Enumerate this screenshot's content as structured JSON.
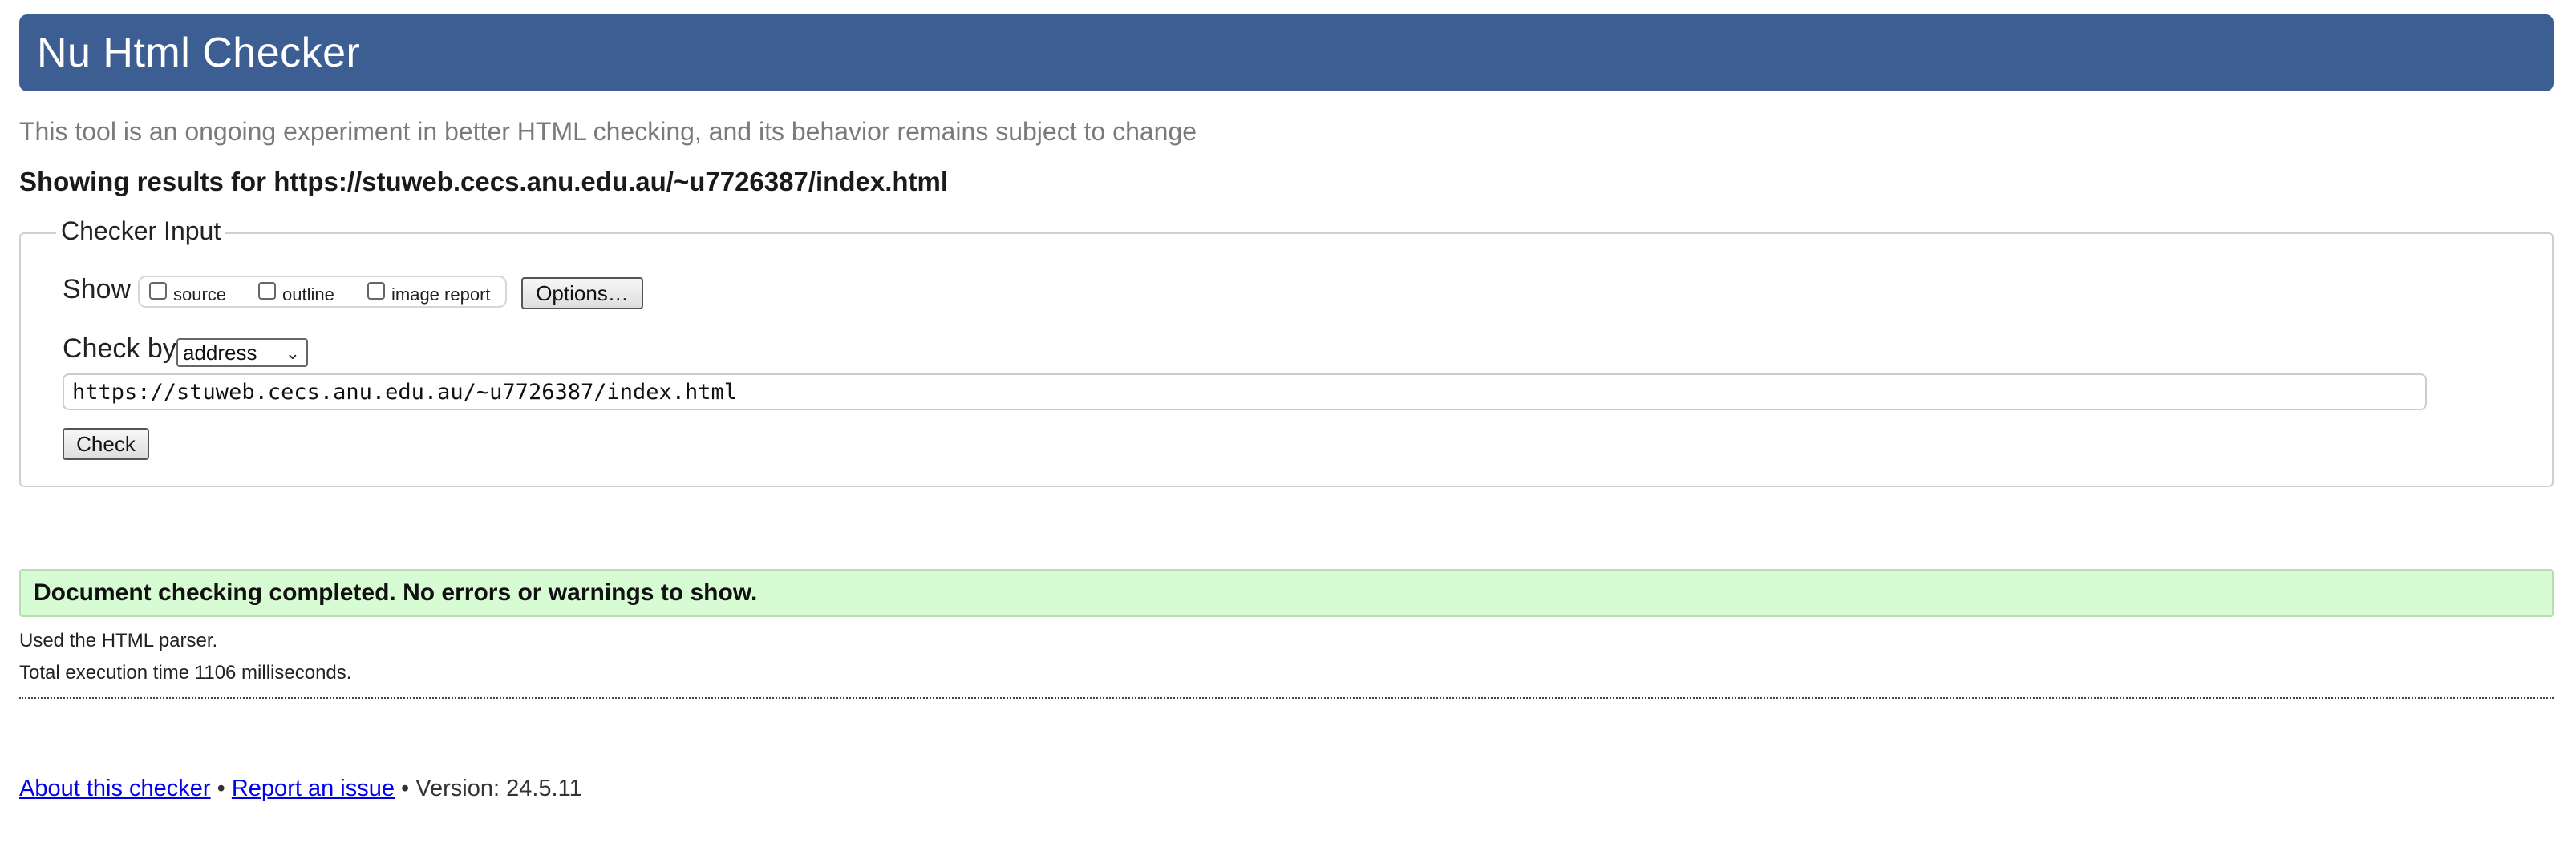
{
  "header": {
    "title": "Nu Html Checker"
  },
  "subtitle": "This tool is an ongoing experiment in better HTML checking, and its behavior remains subject to change",
  "showing_results": "Showing results for https://stuweb.cecs.anu.edu.au/~u7726387/index.html",
  "checker_input": {
    "legend": "Checker Input",
    "show_label": "Show",
    "checkboxes": [
      {
        "label": "source",
        "checked": false
      },
      {
        "label": "outline",
        "checked": false
      },
      {
        "label": "image report",
        "checked": false
      }
    ],
    "options_button": "Options…",
    "check_by_label": "Check by",
    "check_by_selected": "address",
    "url_value": "https://stuweb.cecs.anu.edu.au/~u7726387/index.html",
    "check_button": "Check"
  },
  "result": {
    "message": "Document checking completed. No errors or warnings to show.",
    "parser_note": "Used the HTML parser.",
    "execution_time": "Total execution time 1106 milliseconds."
  },
  "footer": {
    "about_link": "About this checker",
    "separator": "•",
    "report_link": "Report an issue",
    "version": "Version: 24.5.11"
  },
  "colors": {
    "header_bg": "#3c5e93",
    "success_bg": "#d7fcd3",
    "link": "#0000ee"
  }
}
